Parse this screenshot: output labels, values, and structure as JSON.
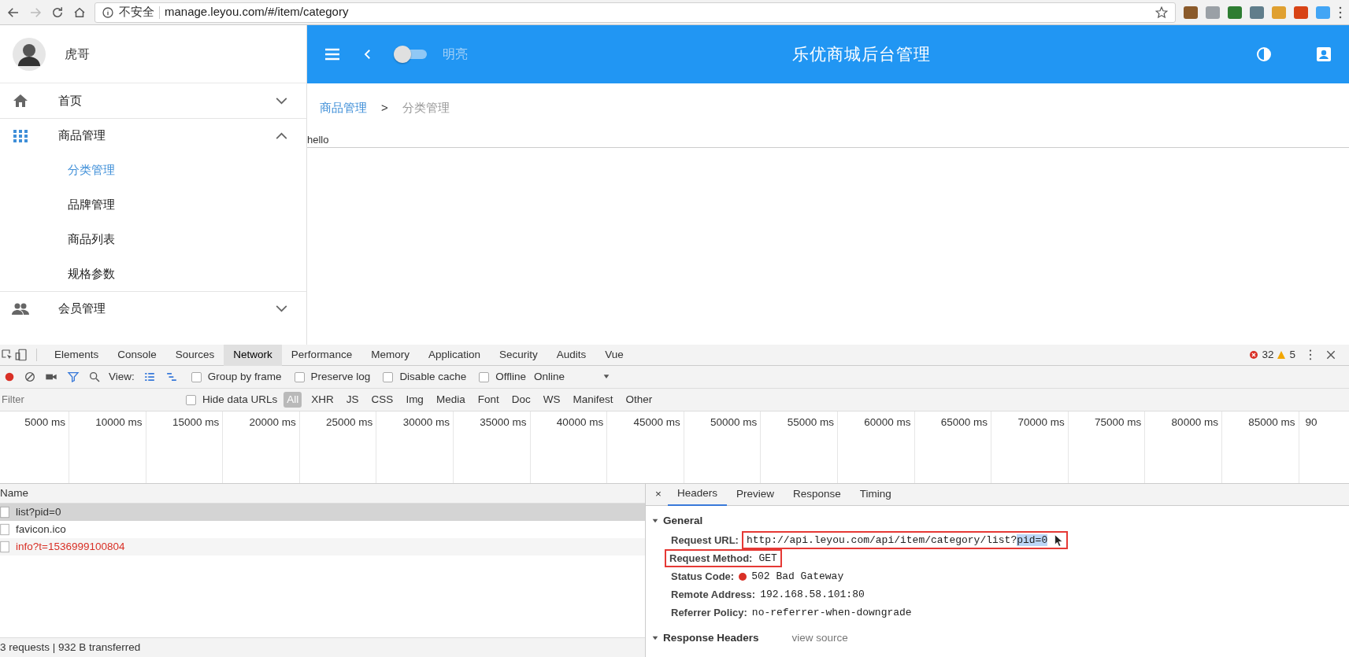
{
  "browser": {
    "security_label": "不安全",
    "url": "manage.leyou.com/#/item/category"
  },
  "app": {
    "user_name": "虎哥",
    "header": {
      "toggle_on": false,
      "toggle_label": "明亮",
      "title": "乐优商城后台管理"
    },
    "sidebar": {
      "items": [
        {
          "label": "首页",
          "kind": "home",
          "expanded": false
        },
        {
          "label": "商品管理",
          "kind": "grid",
          "expanded": true,
          "children": [
            {
              "label": "分类管理",
              "selected": true
            },
            {
              "label": "品牌管理",
              "selected": false
            },
            {
              "label": "商品列表",
              "selected": false
            },
            {
              "label": "规格参数",
              "selected": false
            }
          ]
        },
        {
          "label": "会员管理",
          "kind": "people",
          "expanded": false
        }
      ]
    },
    "breadcrumb": {
      "separator": ">",
      "items": [
        {
          "label": "商品管理",
          "kind": "link"
        },
        {
          "label": "分类管理",
          "kind": "current"
        }
      ]
    },
    "content_text": "hello"
  },
  "devtools": {
    "tabs": [
      {
        "label": "Elements",
        "selected": false
      },
      {
        "label": "Console",
        "selected": false
      },
      {
        "label": "Sources",
        "selected": false
      },
      {
        "label": "Network",
        "selected": true
      },
      {
        "label": "Performance",
        "selected": false
      },
      {
        "label": "Memory",
        "selected": false
      },
      {
        "label": "Application",
        "selected": false
      },
      {
        "label": "Security",
        "selected": false
      },
      {
        "label": "Audits",
        "selected": false
      },
      {
        "label": "Vue",
        "selected": false
      }
    ],
    "errors": "32",
    "warnings": "5",
    "toolbar": {
      "recording": true,
      "filter_active": true,
      "view_label": "View:",
      "checkboxes": [
        {
          "label": "Group by frame",
          "checked": false
        },
        {
          "label": "Preserve log",
          "checked": false
        },
        {
          "label": "Disable cache",
          "checked": false
        },
        {
          "label": "Offline",
          "checked": false
        }
      ],
      "throttle": "Online"
    },
    "filter": {
      "placeholder": "Filter",
      "hide_data_urls": {
        "label": "Hide data URLs",
        "checked": false
      },
      "types": [
        {
          "label": "All",
          "selected": true
        },
        {
          "label": "XHR",
          "selected": false
        },
        {
          "label": "JS",
          "selected": false
        },
        {
          "label": "CSS",
          "selected": false
        },
        {
          "label": "Img",
          "selected": false
        },
        {
          "label": "Media",
          "selected": false
        },
        {
          "label": "Font",
          "selected": false
        },
        {
          "label": "Doc",
          "selected": false
        },
        {
          "label": "WS",
          "selected": false
        },
        {
          "label": "Manifest",
          "selected": false
        },
        {
          "label": "Other",
          "selected": false
        }
      ]
    },
    "timeline": {
      "ticks": [
        "5000 ms",
        "10000 ms",
        "15000 ms",
        "20000 ms",
        "25000 ms",
        "30000 ms",
        "35000 ms",
        "40000 ms",
        "45000 ms",
        "50000 ms",
        "55000 ms",
        "60000 ms",
        "65000 ms",
        "70000 ms",
        "75000 ms",
        "80000 ms",
        "85000 ms",
        "90"
      ]
    },
    "requests": {
      "column": "Name",
      "rows": [
        {
          "name": "list?pid=0",
          "selected": true,
          "failed": false
        },
        {
          "name": "favicon.ico",
          "selected": false,
          "failed": false
        },
        {
          "name": "info?t=1536999100804",
          "selected": false,
          "failed": true
        }
      ],
      "summary": "3 requests | 932 B transferred"
    },
    "detail": {
      "close": "×",
      "tabs": [
        {
          "label": "Headers",
          "selected": true
        },
        {
          "label": "Preview",
          "selected": false
        },
        {
          "label": "Response",
          "selected": false
        },
        {
          "label": "Timing",
          "selected": false
        }
      ],
      "sections": [
        {
          "title": "General",
          "expanded": true,
          "rows": [
            {
              "label": "Request URL:",
              "kind": "url",
              "label_highlighted": false,
              "value_highlighted": true,
              "value_parts": [
                {
                  "text": "http://api.leyou.com/api/item/category/list?",
                  "selected": false
                },
                {
                  "text": "pid=0",
                  "selected": true
                }
              ]
            },
            {
              "label": "Request Method:",
              "kind": "plain",
              "label_highlighted": true,
              "value_highlighted": true,
              "value": "GET"
            },
            {
              "label": "Status Code:",
              "kind": "status",
              "value": "502 Bad Gateway"
            },
            {
              "label": "Remote Address:",
              "kind": "plain",
              "value": "192.168.58.101:80"
            },
            {
              "label": "Referrer Policy:",
              "kind": "plain",
              "value": "no-referrer-when-downgrade"
            }
          ]
        },
        {
          "title": "Response Headers",
          "expanded": true,
          "link": "view source"
        }
      ]
    }
  }
}
